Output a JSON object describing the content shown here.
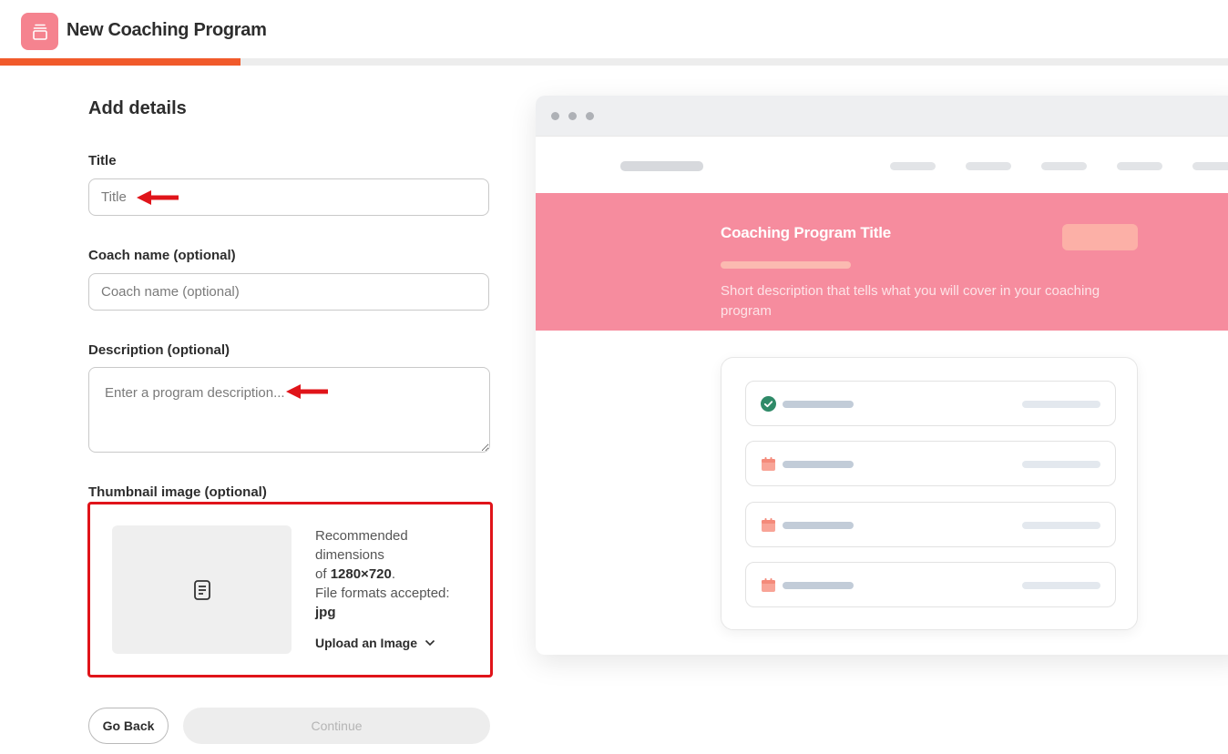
{
  "header": {
    "title": "New Coaching Program",
    "logo_icon": "stacked-layers-icon",
    "progress_fraction": 0.196,
    "accent_color": "#f15a2b",
    "logo_color": "#f5838f"
  },
  "form": {
    "section_title": "Add details",
    "title_field": {
      "label": "Title",
      "placeholder": "Title",
      "value": ""
    },
    "coach_field": {
      "label": "Coach name (optional)",
      "placeholder": "Coach name (optional)",
      "value": ""
    },
    "description_field": {
      "label": "Description (optional)",
      "placeholder": "Enter a program description...",
      "value": ""
    },
    "thumbnail": {
      "label": "Thumbnail image (optional)",
      "icon": "document-icon",
      "info_line1": "Recommended",
      "info_line2": "dimensions",
      "info_line3_prefix": "of ",
      "dimensions": "1280×720",
      "info_line3_suffix": ".",
      "info_line4": "File formats accepted:",
      "formats": "jpg",
      "upload_label": "Upload an Image"
    },
    "buttons": {
      "back": "Go Back",
      "continue": "Continue"
    }
  },
  "preview": {
    "hero_title": "Coaching Program Title",
    "hero_description": "Short description that tells what you will cover in your coaching program",
    "hero_color": "#f68c9e",
    "rows": [
      {
        "icon": "check-circle-icon"
      },
      {
        "icon": "calendar-icon"
      },
      {
        "icon": "calendar-icon"
      },
      {
        "icon": "calendar-icon"
      }
    ]
  }
}
